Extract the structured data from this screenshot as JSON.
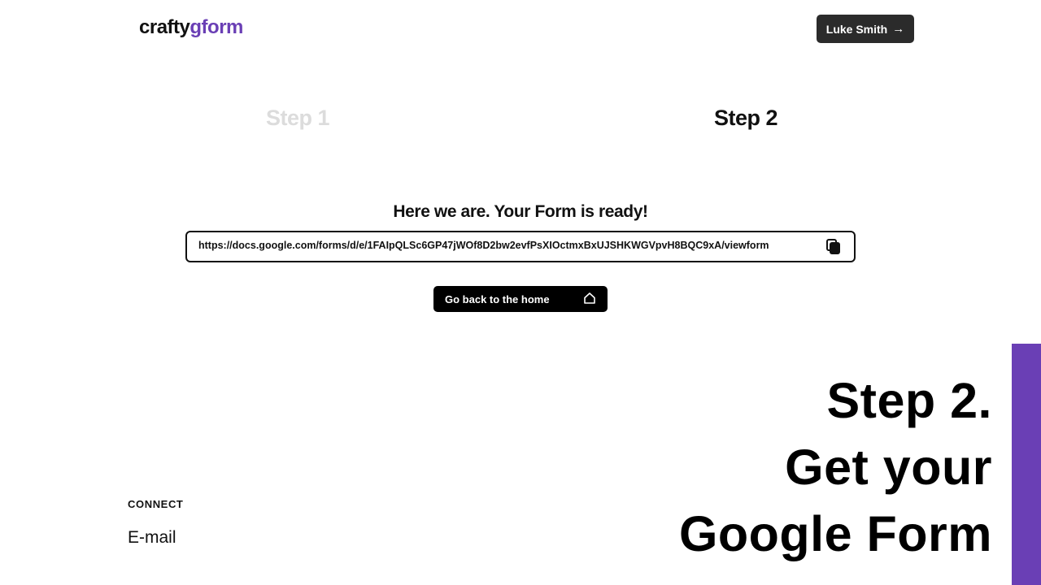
{
  "header": {
    "logo_part1": "crafty",
    "logo_part2": "gform",
    "user_name": "Luke Smith",
    "user_arrow": "→"
  },
  "steps": {
    "step1": "Step 1",
    "step2": "Step 2"
  },
  "result": {
    "title": "Here we are. Your Form is ready!",
    "url": "https://docs.google.com/forms/d/e/1FAIpQLSc6GP47jWOf8D2bw2evfPsXIOctmxBxUJSHKWGVpvH8BQC9xA/viewform",
    "copy_icon": "copy-icon",
    "home_button": "Go back to the home",
    "home_icon": "home-icon"
  },
  "promo": {
    "line1": "Step 2.",
    "line2": "Get your",
    "line3": "Google Form"
  },
  "footer": {
    "connect_label": "CONNECT",
    "email_link": "E-mail"
  },
  "colors": {
    "brand_purple": "#6a3fb5",
    "button_dark": "#2b2b2b",
    "inactive_step": "#dcdcdc"
  }
}
